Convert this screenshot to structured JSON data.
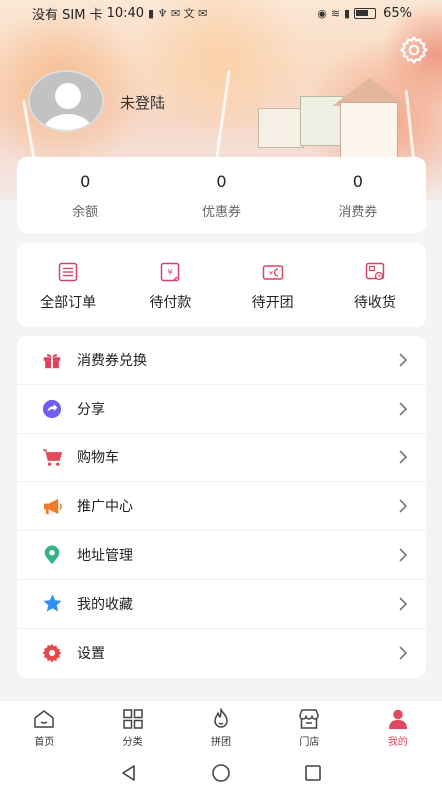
{
  "status_bar": {
    "carrier": "没有 SIM 卡",
    "time": "10:40",
    "battery": "65%"
  },
  "profile": {
    "username": "未登陆"
  },
  "stats": [
    {
      "value": "0",
      "label": "余额"
    },
    {
      "value": "0",
      "label": "优惠券"
    },
    {
      "value": "0",
      "label": "消费券"
    }
  ],
  "orders": [
    {
      "label": "全部订单",
      "icon": "list-icon"
    },
    {
      "label": "待付款",
      "icon": "yen-card-icon"
    },
    {
      "label": "待开团",
      "icon": "wallet-icon"
    },
    {
      "label": "待收货",
      "icon": "package-icon"
    }
  ],
  "menu": [
    {
      "label": "消费券兑换",
      "icon": "gift-icon",
      "color": "#e0405a"
    },
    {
      "label": "分享",
      "icon": "share-icon",
      "color": "#6d5ef0"
    },
    {
      "label": "购物车",
      "icon": "cart-icon",
      "color": "#e24a5a"
    },
    {
      "label": "推广中心",
      "icon": "megaphone-icon",
      "color": "#f07a2a"
    },
    {
      "label": "地址管理",
      "icon": "location-pin-icon",
      "color": "#36b38a"
    },
    {
      "label": "我的收藏",
      "icon": "star-icon",
      "color": "#2f8ef2"
    },
    {
      "label": "设置",
      "icon": "gear-icon",
      "color": "#e24a4a"
    }
  ],
  "tabs": [
    {
      "label": "首页",
      "icon": "home-icon",
      "active": false
    },
    {
      "label": "分类",
      "icon": "grid-icon",
      "active": false
    },
    {
      "label": "拼团",
      "icon": "flame-icon",
      "active": false
    },
    {
      "label": "门店",
      "icon": "store-icon",
      "active": false
    },
    {
      "label": "我的",
      "icon": "person-icon",
      "active": true
    }
  ],
  "colors": {
    "accent": "#e1495e",
    "order_icon": "#d6446a"
  }
}
